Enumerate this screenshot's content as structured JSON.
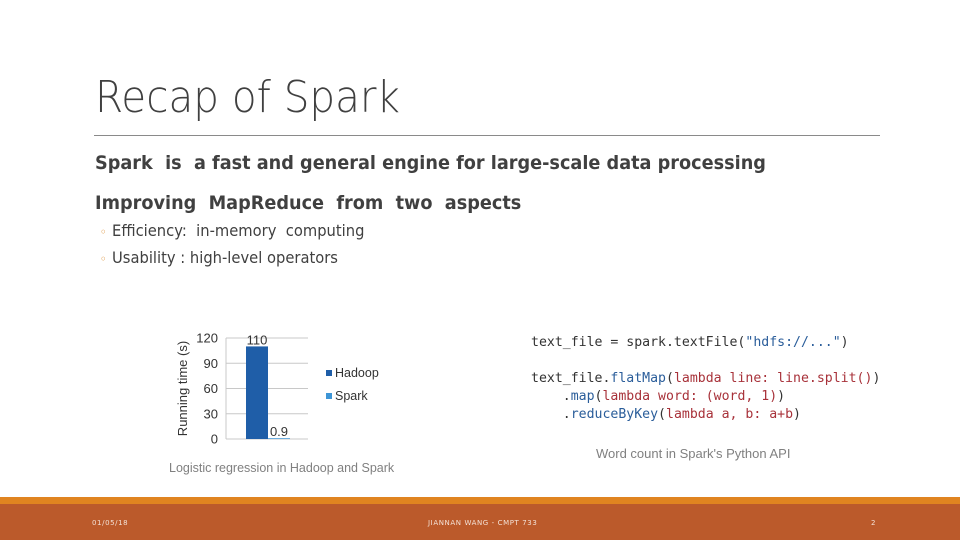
{
  "slide": {
    "title": "Recap of  Spark",
    "bullets": [
      {
        "level": 1,
        "text": "Spark  is  a fast and general engine for large-scale data processing"
      },
      {
        "level": 1,
        "text": "Improving  MapReduce  from  two  aspects"
      },
      {
        "level": 2,
        "text": "Efficiency:  in-memory  computing"
      },
      {
        "level": 2,
        "text": "Usability : high-level operators"
      }
    ],
    "bullet_glyph": "◦"
  },
  "chart_data": {
    "type": "bar",
    "title": "Logistic regression in Hadoop and Spark",
    "xlabel": "",
    "ylabel": "Running time (s)",
    "ylim": [
      0,
      120
    ],
    "yticks": [
      0,
      30,
      60,
      90,
      120
    ],
    "ytick_labels": [
      "0",
      "30",
      "60",
      "90",
      "120"
    ],
    "categories": [
      ""
    ],
    "grid": true,
    "legend_position": "right",
    "series": [
      {
        "name": "Hadoop",
        "values": [
          110
        ],
        "label": "110",
        "color": "#1f5ea8"
      },
      {
        "name": "Spark",
        "values": [
          0.9
        ],
        "label": "0.9",
        "color": "#3d95d6"
      }
    ]
  },
  "code": {
    "lines": [
      [
        {
          "t": "text_file = spark.textFile(",
          "c": ""
        },
        {
          "t": "\"hdfs://...\"",
          "c": "blue"
        },
        {
          "t": ")",
          "c": ""
        }
      ],
      [
        {
          "t": "text_file.",
          "c": ""
        },
        {
          "t": "flatMap",
          "c": "blue"
        },
        {
          "t": "(",
          "c": ""
        },
        {
          "t": "lambda line: line.split()",
          "c": "red"
        },
        {
          "t": ")",
          "c": ""
        }
      ],
      [
        {
          "t": "    .",
          "c": ""
        },
        {
          "t": "map",
          "c": "blue"
        },
        {
          "t": "(",
          "c": ""
        },
        {
          "t": "lambda word: (word, 1)",
          "c": "red"
        },
        {
          "t": ")",
          "c": ""
        }
      ],
      [
        {
          "t": "    .",
          "c": ""
        },
        {
          "t": "reduceByKey",
          "c": "blue"
        },
        {
          "t": "(",
          "c": ""
        },
        {
          "t": "lambda a, b: a+b",
          "c": "red"
        },
        {
          "t": ")",
          "c": ""
        }
      ]
    ],
    "caption": "Word count in Spark's Python API"
  },
  "footer": {
    "date": "01/05/18",
    "author_course": "JIANNAN WANG - CMPT 733",
    "page_number": "2",
    "colors": {
      "accent": "#e08420",
      "bar": "#bb5a2b"
    }
  }
}
